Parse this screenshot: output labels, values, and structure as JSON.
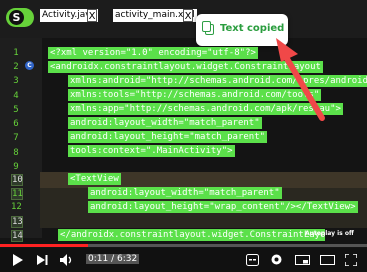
{
  "tabs": [
    {
      "label": "Activity.java",
      "close": "X"
    },
    {
      "label": "activity_main.xml",
      "close": "X"
    }
  ],
  "logo_letter": "S",
  "toast": {
    "text": "Text copied"
  },
  "line_numbers": [
    "1",
    "2",
    "3",
    "4",
    "5",
    "6",
    "7",
    "8",
    "9",
    "10",
    "11",
    "12",
    "13",
    "14"
  ],
  "code_lines": [
    {
      "text": "<?xml  version=\"1.0\"  encoding=\"utf-8\"?>"
    },
    {
      "text": "<androidx.constraintlayout.widget.ConstraintLayout"
    },
    {
      "text": "xmlns:android=\"http://schemas.android.com/apres/android\""
    },
    {
      "text": "xmlns:tools=\"http://schemas.android.com/tools\""
    },
    {
      "text": "xmlns:app=\"http://schemas.android.com/apk/res-au\">"
    },
    {
      "text": "android:layout_width=\"match_parent\""
    },
    {
      "text": "android:layout_height=\"match_parent\""
    },
    {
      "text": "tools:context=\".MainActivity\">"
    },
    {
      "text": "<TextView"
    },
    {
      "text": "android:layout_width=\"match_parent\""
    },
    {
      "text": "android:layout_height=\"wrap_content\"/></TextView>"
    },
    {
      "text": "</androidx.constraintlayout.widget.ConstraintLayou"
    }
  ],
  "player": {
    "autoplay_label": "Autoplay is off",
    "time": "0:11 / 6:32",
    "progress": 0.24
  },
  "colors": {
    "code_highlight": "#5be04a",
    "progress": "#ff2222",
    "toast_text": "#2a9d3e"
  }
}
